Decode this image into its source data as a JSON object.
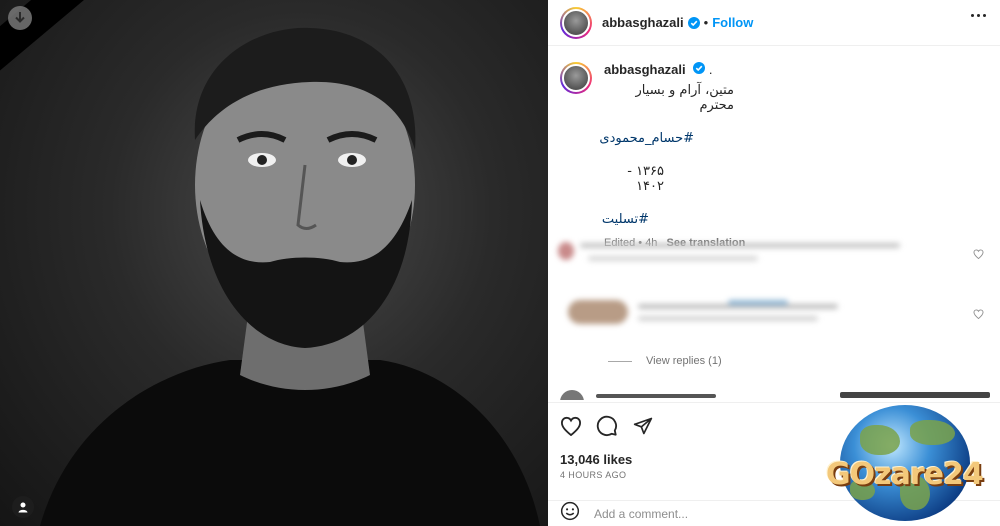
{
  "post": {
    "username": "abbasghazali",
    "follow_label": "Follow",
    "dot_separator": "•",
    "caption_suffix": ".",
    "caption_lines": [
      "متین، آرام و بسیار محترم",
      "#حسام_محمودی",
      "۱۳۶۵ - ۱۴۰۲",
      "#تسلیت"
    ],
    "edited_label": "Edited",
    "time_short": "4h",
    "see_translation": "See translation",
    "view_replies": "View replies (1)",
    "likes": "13,046 likes",
    "time_ago": "4 HOURS AGO",
    "add_comment_placeholder": "Add a comment..."
  },
  "watermark": {
    "text": "GOzare24"
  },
  "colors": {
    "link": "#0095f6",
    "hashtag": "#00376b",
    "muted": "#737373",
    "verified": "#0095f6"
  },
  "icons": [
    "download-icon",
    "user-tag-icon",
    "verified-icon",
    "more-icon",
    "heart-icon",
    "comment-icon",
    "share-icon",
    "emoji-icon"
  ]
}
